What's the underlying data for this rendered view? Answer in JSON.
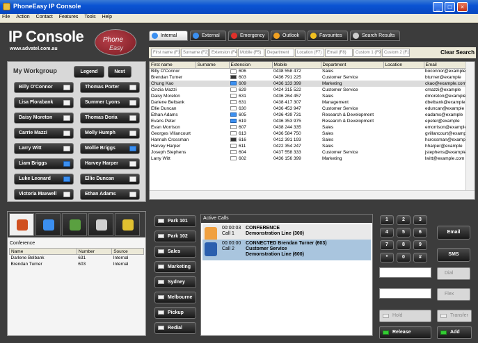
{
  "window": {
    "title": "PhoneEasy IP Console",
    "controls": [
      "_",
      "□",
      "×"
    ]
  },
  "menu": [
    "File",
    "Action",
    "Contact",
    "Features",
    "Tools",
    "Help"
  ],
  "logo": {
    "title": "IP Console",
    "subtitle": "www.advatel.com.au",
    "badge_line1": "Phone",
    "badge_line2": "Easy"
  },
  "workgroup": {
    "title": "My Workgroup",
    "legend_label": "Legend",
    "next_label": "Next",
    "agents": [
      {
        "name": "Billy O'Connor",
        "status": "white"
      },
      {
        "name": "Thomas Porter",
        "status": "white"
      },
      {
        "name": "Lisa Florabank",
        "status": "white"
      },
      {
        "name": "Summer Lyons",
        "status": "white"
      },
      {
        "name": "Daisy Moreton",
        "status": "white"
      },
      {
        "name": "Thomas Doria",
        "status": "white"
      },
      {
        "name": "Carrie Mazzi",
        "status": "white"
      },
      {
        "name": "Molly Humph",
        "status": "white"
      },
      {
        "name": "Larry Witt",
        "status": "white"
      },
      {
        "name": "Mollie Briggs",
        "status": "blue"
      },
      {
        "name": "Liam Briggs",
        "status": "blue"
      },
      {
        "name": "Harvey Harper",
        "status": "white"
      },
      {
        "name": "Luke Leonard",
        "status": "blue"
      },
      {
        "name": "Ellie Duncan",
        "status": "white"
      },
      {
        "name": "Victoria Maxwell",
        "status": "white"
      },
      {
        "name": "Ethan Adams",
        "status": "white"
      }
    ]
  },
  "tabs": [
    {
      "label": "Internal",
      "icon": "globe-icon",
      "color": "#3b8ff0",
      "active": true
    },
    {
      "label": "External",
      "icon": "globe-icon",
      "color": "#3b8ff0",
      "active": false
    },
    {
      "label": "Emergency",
      "icon": "plus-icon",
      "color": "#e0302a",
      "active": false
    },
    {
      "label": "Outlook",
      "icon": "outlook-icon",
      "color": "#f0a020",
      "active": false
    },
    {
      "label": "Favourites",
      "icon": "star-icon",
      "color": "#f0c020",
      "active": false
    },
    {
      "label": "Search Results",
      "icon": "search-icon",
      "color": "#cccccc",
      "active": false
    }
  ],
  "filters": [
    "First name (F1)",
    "Surname (F2)",
    "Extension (F4)",
    "Mobile (F5)",
    "Department",
    "Location (F7)",
    "Email (F8)",
    "Custom 1 (F9)",
    "Custom 2 (F10)"
  ],
  "clear_search_label": "Clear Search",
  "directory": {
    "columns": [
      "First name",
      "Surname",
      "Extension",
      "Mobile",
      "Department",
      "Location",
      "Email"
    ],
    "rows": [
      {
        "first": "Billy O'Connor",
        "ext": "606",
        "ext_icon": "white",
        "mobile": "0438 558 472",
        "dept": "Sales",
        "email": "boconnor@example"
      },
      {
        "first": "Brendan Turner",
        "ext": "603",
        "ext_icon": "dark",
        "mobile": "0436 791 225",
        "dept": "Customer Service",
        "email": "bturner@example"
      },
      {
        "first": "Chung Kao",
        "ext": "609",
        "ext_icon": "blue",
        "mobile": "0436 133 399",
        "dept": "Marketing",
        "email": "ckao@example.com",
        "selected": true
      },
      {
        "first": "Cinzia Mazzi",
        "ext": "629",
        "ext_icon": "white",
        "mobile": "0424 315 522",
        "dept": "Customer Service",
        "email": "cmazzi@example"
      },
      {
        "first": "Daisy Moreton",
        "ext": "631",
        "ext_icon": "white",
        "mobile": "0436 264 457",
        "dept": "Sales",
        "email": "dmoreton@example"
      },
      {
        "first": "Darlene Belbank",
        "ext": "631",
        "ext_icon": "white",
        "mobile": "0438 417 307",
        "dept": "Management",
        "email": "dbelbank@example"
      },
      {
        "first": "Ellie Duncan",
        "ext": "630",
        "ext_icon": "white",
        "mobile": "0436 453 947",
        "dept": "Customer Service",
        "email": "eduncan@example"
      },
      {
        "first": "Ethan Adams",
        "ext": "605",
        "ext_icon": "blue",
        "mobile": "0436 439 731",
        "dept": "Research & Development",
        "email": "eadams@example"
      },
      {
        "first": "Evans Peter",
        "ext": "619",
        "ext_icon": "blue",
        "mobile": "0436 353 975",
        "dept": "Research & Development",
        "email": "epeter@example"
      },
      {
        "first": "Evan Morrison",
        "ext": "607",
        "ext_icon": "white",
        "mobile": "0438 244 335",
        "dept": "Sales",
        "email": "emorrison@example"
      },
      {
        "first": "Georges Villancourt",
        "ext": "613",
        "ext_icon": "white",
        "mobile": "0436 584 750",
        "dept": "Sales",
        "email": "gvillancourt@example"
      },
      {
        "first": "Hannah Crossman",
        "ext": "616",
        "ext_icon": "dark",
        "mobile": "0412 391 193",
        "dept": "Sales",
        "email": "hcrossman@example"
      },
      {
        "first": "Harvey Harper",
        "ext": "611",
        "ext_icon": "white",
        "mobile": "0422 354 247",
        "dept": "Sales",
        "email": "hharper@example"
      },
      {
        "first": "Joseph Stephens",
        "ext": "604",
        "ext_icon": "white",
        "mobile": "0437 558 333",
        "dept": "Customer Service",
        "email": "jstephens@example"
      },
      {
        "first": "Larry Witt",
        "ext": "602",
        "ext_icon": "white",
        "mobile": "0436 156 399",
        "dept": "Marketing",
        "email": "lwitt@example.com"
      }
    ]
  },
  "conference": {
    "label": "Conference",
    "columns": [
      "Name",
      "Number",
      "Source"
    ],
    "rows": [
      {
        "name": "Darlene Belbank",
        "number": "631",
        "source": "Internal"
      },
      {
        "name": "Brendan Turner",
        "number": "603",
        "source": "Internal"
      }
    ]
  },
  "park_buttons": [
    "Park 101",
    "Park 102",
    "Sales",
    "Marketing",
    "Sydney",
    "Melbourne",
    "Pickup",
    "Redial"
  ],
  "active_calls": {
    "header": "Active Calls",
    "calls": [
      {
        "time": "00:00:03",
        "slot": "Call 1",
        "line1": "CONFERENCE",
        "line2": "Demonstration Line (300)",
        "line3": ""
      },
      {
        "time": "00:00:00",
        "slot": "Call 2",
        "line1": "CONNECTED Brendan Turner (603)",
        "line2": "Customer Service",
        "line3": "Demonstration Line (600)"
      }
    ]
  },
  "dialpad": [
    "1",
    "2",
    "3",
    "4",
    "5",
    "6",
    "7",
    "8",
    "9",
    "*",
    "0",
    "#"
  ],
  "actions": {
    "email": "Email",
    "sms": "SMS",
    "dial": "Dial",
    "flex": "Flex"
  },
  "bottom_buttons": {
    "hold": "Hold",
    "transfer": "Transfer",
    "release": "Release",
    "add": "Add"
  }
}
